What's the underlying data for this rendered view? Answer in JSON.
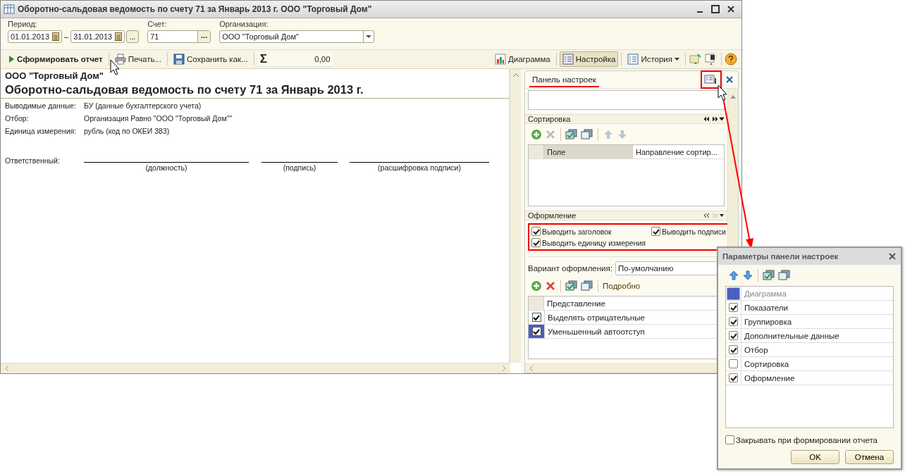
{
  "window": {
    "title": "Оборотно-сальдовая ведомость по счету 71 за Январь 2013 г. ООО \"Торговый Дом\""
  },
  "filters": {
    "period_label": "Период:",
    "date_from": "01.01.2013",
    "dash": "–",
    "date_to": "31.01.2013",
    "more": "...",
    "account_label": "Счет:",
    "account": "71",
    "organization_label": "Организация:",
    "organization": "ООО \"Торговый Дом\""
  },
  "toolbar": {
    "left": [
      {
        "kind": "run",
        "label": "Сформировать отчет"
      },
      {
        "kind": "print",
        "label": "Печать..."
      },
      {
        "kind": "save",
        "label": "Сохранить как..."
      }
    ],
    "sum_symbol": "Σ",
    "sum": "0,00",
    "right": [
      {
        "kind": "chart",
        "label": "Диаграмма",
        "selected": false
      },
      {
        "kind": "settings",
        "label": "Настройка",
        "selected": true
      },
      {
        "kind": "history",
        "label": "История",
        "selected": false
      }
    ]
  },
  "report": {
    "company": "ООО \"Торговый Дом\"",
    "title": "Оборотно-сальдовая ведомость по счету 71 за Январь 2013 г.",
    "params": [
      {
        "label": "Выводимые данные:",
        "value": "БУ (данные бухгалтерского учета)"
      },
      {
        "label": "Отбор:",
        "value": "Организация Равно \"ООО \"Торговый Дом\"\""
      },
      {
        "label": "Единица измерения:",
        "value": "рубль (код по ОКЕИ 383)"
      }
    ],
    "signature": {
      "label": "Ответственный:",
      "fields": [
        "(должность)",
        "(подпись)",
        "(расшифровка подписи)"
      ]
    }
  },
  "settings_panel": {
    "title": "Панель настроек",
    "sorting": {
      "title": "Сортировка",
      "columns": [
        "Поле",
        "Направление сортир..."
      ]
    },
    "appearance": {
      "title": "Оформление",
      "options": [
        {
          "label": "Выводить заголовок",
          "checked": true
        },
        {
          "label": "Выводить подписи",
          "checked": true
        },
        {
          "label": "Выводить единицу измерения",
          "checked": true
        }
      ],
      "variant_label": "Вариант оформления:",
      "variant": "По-умолчанию",
      "details": "Подробно",
      "column": "Представление",
      "rows": [
        {
          "label": "Выделять отрицательные",
          "checked": true,
          "selected": false
        },
        {
          "label": "Уменьшенный автоотступ",
          "checked": true,
          "selected": true
        }
      ]
    }
  },
  "dialog": {
    "title": "Параметры панели настроек",
    "items": [
      {
        "label": "Диаграмма",
        "checked": false,
        "disabled": true
      },
      {
        "label": "Показатели",
        "checked": true,
        "disabled": false
      },
      {
        "label": "Группировка",
        "checked": true,
        "disabled": false
      },
      {
        "label": "Дополнительные данные",
        "checked": true,
        "disabled": false
      },
      {
        "label": "Отбор",
        "checked": true,
        "disabled": false
      },
      {
        "label": "Сортировка",
        "checked": false,
        "disabled": false
      },
      {
        "label": "Оформление",
        "checked": true,
        "disabled": false
      }
    ],
    "close_option": {
      "label": "Закрывать при формировании отчета",
      "checked": false
    },
    "buttons": [
      "OK",
      "Отмена"
    ]
  }
}
